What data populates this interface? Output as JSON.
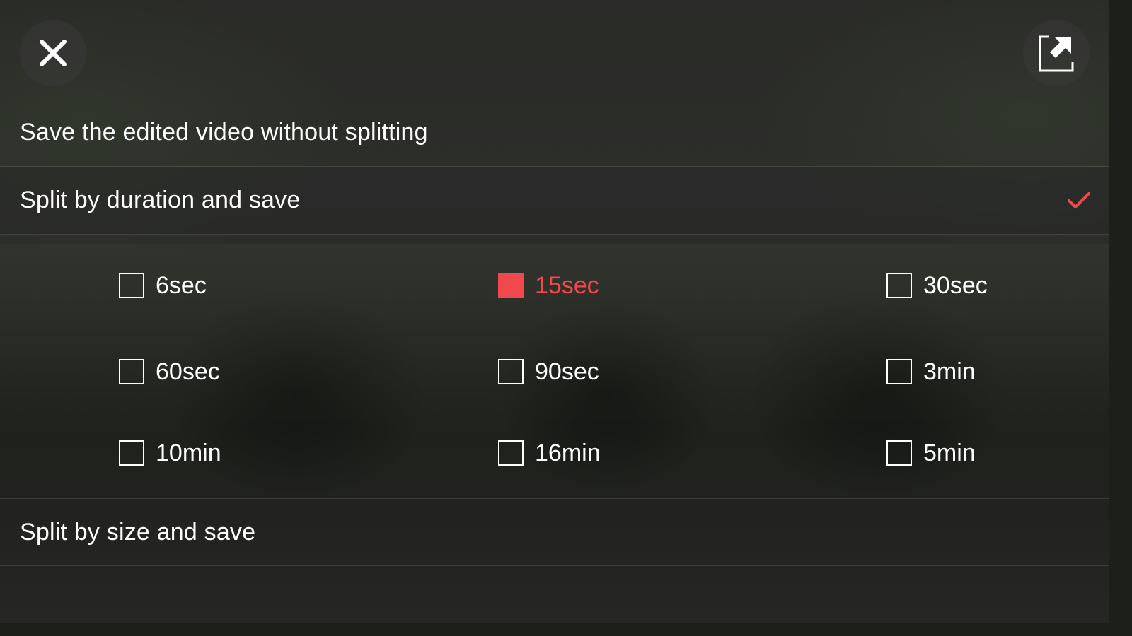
{
  "colors": {
    "accent": "#f0484c",
    "text": "#ffffff"
  },
  "header": {
    "close_icon": "close-icon",
    "export_icon": "export-icon"
  },
  "menu": {
    "no_split_label": "Save the edited video without splitting",
    "duration_label": "Split by duration and save",
    "duration_selected": true,
    "size_label": "Split by size and save"
  },
  "durations": [
    {
      "label": "6sec",
      "selected": false
    },
    {
      "label": "15sec",
      "selected": true
    },
    {
      "label": "30sec",
      "selected": false
    },
    {
      "label": "60sec",
      "selected": false
    },
    {
      "label": "90sec",
      "selected": false
    },
    {
      "label": "3min",
      "selected": false
    },
    {
      "label": "10min",
      "selected": false
    },
    {
      "label": "16min",
      "selected": false
    },
    {
      "label": "5min",
      "selected": false
    }
  ]
}
